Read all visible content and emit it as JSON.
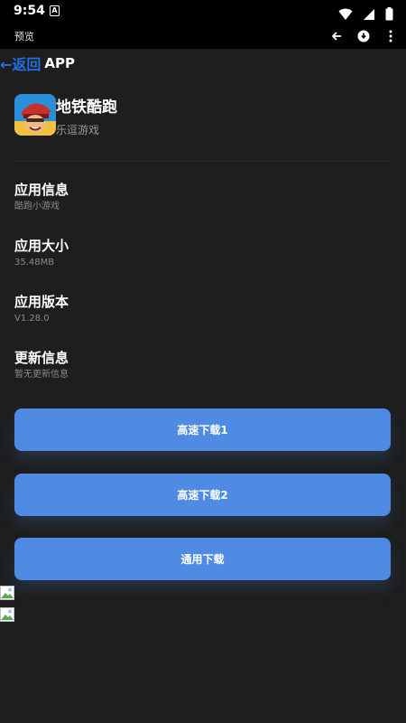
{
  "status_bar": {
    "time": "9:54",
    "app_icon_letter": "A"
  },
  "toolbar": {
    "title": "预览"
  },
  "nav": {
    "back_label": "←返回",
    "title": "APP"
  },
  "app": {
    "name": "地铁酷跑",
    "developer": "乐逗游戏"
  },
  "info": [
    {
      "label": "应用信息",
      "value": "酷跑小游戏"
    },
    {
      "label": "应用大小",
      "value": "35.48MB"
    },
    {
      "label": "应用版本",
      "value": "V1.28.0"
    },
    {
      "label": "更新信息",
      "value": "暂无更新信息"
    }
  ],
  "buttons": {
    "download1": "高速下载1",
    "download2": "高速下载2",
    "download_general": "通用下载"
  },
  "colors": {
    "accent": "#4f8ae3",
    "link": "#1e6fe6",
    "background": "#1e1e1e"
  }
}
